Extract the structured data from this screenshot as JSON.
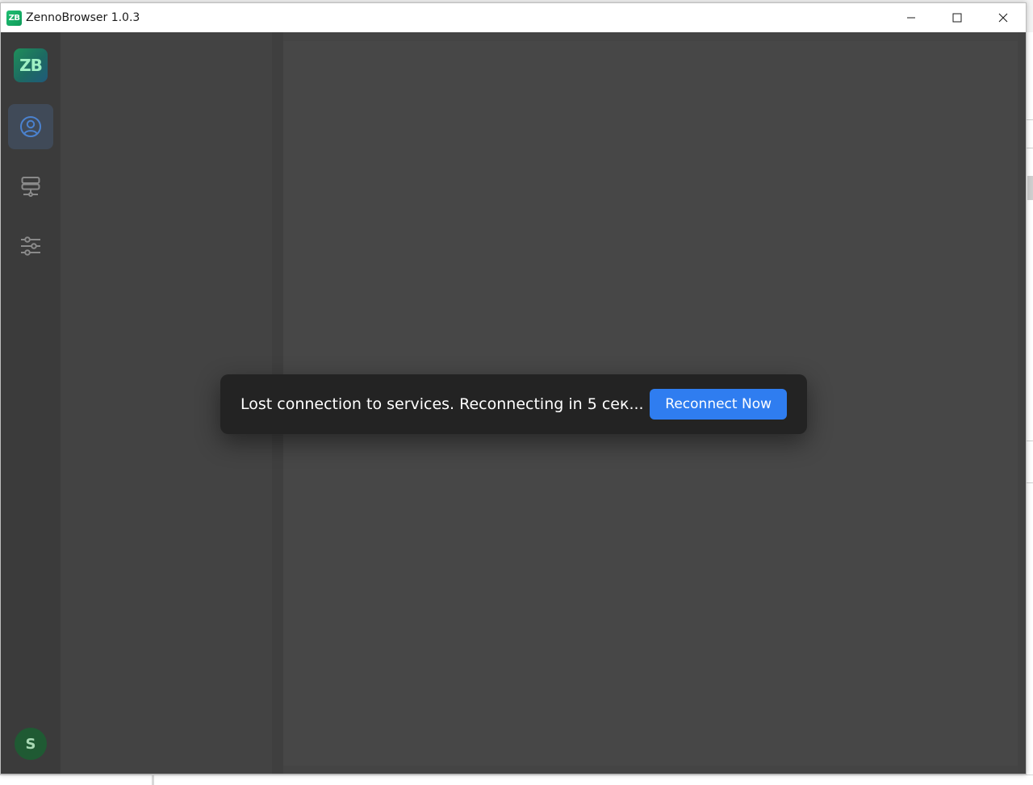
{
  "window": {
    "title": "ZennoBrowser 1.0.3",
    "logo_text": "ZB"
  },
  "sidebar": {
    "brand_text": "ZB",
    "items": [
      {
        "name": "profiles",
        "icon": "user-circle-icon",
        "active": true
      },
      {
        "name": "proxies",
        "icon": "server-network-icon",
        "active": false
      },
      {
        "name": "settings",
        "icon": "sliders-icon",
        "active": false
      }
    ],
    "avatar_initial": "S"
  },
  "toast": {
    "message": "Lost connection to services. Reconnecting in 5 сек...",
    "button_label": "Reconnect Now"
  },
  "colors": {
    "accent": "#2f7df0",
    "brand_green": "#1fbf72",
    "window_bg": "#444444"
  }
}
